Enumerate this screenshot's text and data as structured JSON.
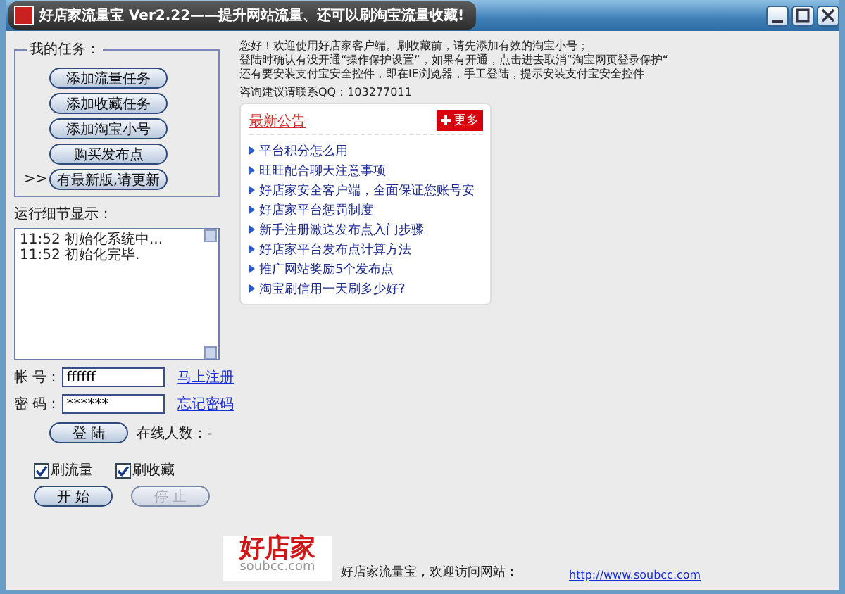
{
  "window": {
    "title": "好店家流量宝 Ver2.22——提升网站流量、还可以刷淘宝流量收藏!"
  },
  "tasks": {
    "title": "我的任务：",
    "buttons": [
      {
        "label": "添加流量任务"
      },
      {
        "label": "添加收藏任务"
      },
      {
        "label": "添加淘宝小号"
      },
      {
        "label": "购买发布点"
      },
      {
        "label": "有最新版,请更新",
        "marker": ">>"
      }
    ]
  },
  "log": {
    "label": "运行细节显示：",
    "lines": [
      "11:52 初始化系统中...",
      "11:52 初始化完毕."
    ]
  },
  "login": {
    "account_label": "帐 号：",
    "account_value": "ffffff",
    "register_link": "马上注册",
    "password_label": "密 码：",
    "password_value": "******",
    "forgot_link": "忘记密码",
    "login_button": "登 陆",
    "online_label": "在线人数：-"
  },
  "options": [
    {
      "label": "刷流量",
      "checked": true
    },
    {
      "label": "刷收藏",
      "checked": true
    }
  ],
  "actions": [
    {
      "label": "开 始",
      "disabled": false
    },
    {
      "label": "停 止",
      "disabled": true
    }
  ],
  "intro": {
    "lines": [
      "您好！欢迎使用好店家客户端。刷收藏前，请先添加有效的淘宝小号；",
      "登陆时确认有没开通“操作保护设置”，如果有开通，点击进去取消”淘宝网页登录保护“",
      "还有要安装支付宝安全控件，即在IE浏览器，手工登陆，提示安装支付宝安全控件"
    ],
    "contact": "咨询建议请联系QQ：103277011"
  },
  "notices": {
    "title": "最新公告",
    "more": "更多",
    "items": [
      "平台积分怎么用",
      "旺旺配合聊天注意事项",
      "好店家安全客户端，全面保证您账号安",
      "好店家平台惩罚制度",
      "新手注册激送发布点入门步骤",
      "好店家平台发布点计算方法",
      "推广网站奖励5个发布点",
      "淘宝刷信用一天刷多少好?"
    ]
  },
  "footer": {
    "logo": "好店家",
    "logo_domain": "soubcc.com",
    "text": "好店家流量宝，欢迎访问网站：",
    "link": "http://www.soubcc.com"
  }
}
